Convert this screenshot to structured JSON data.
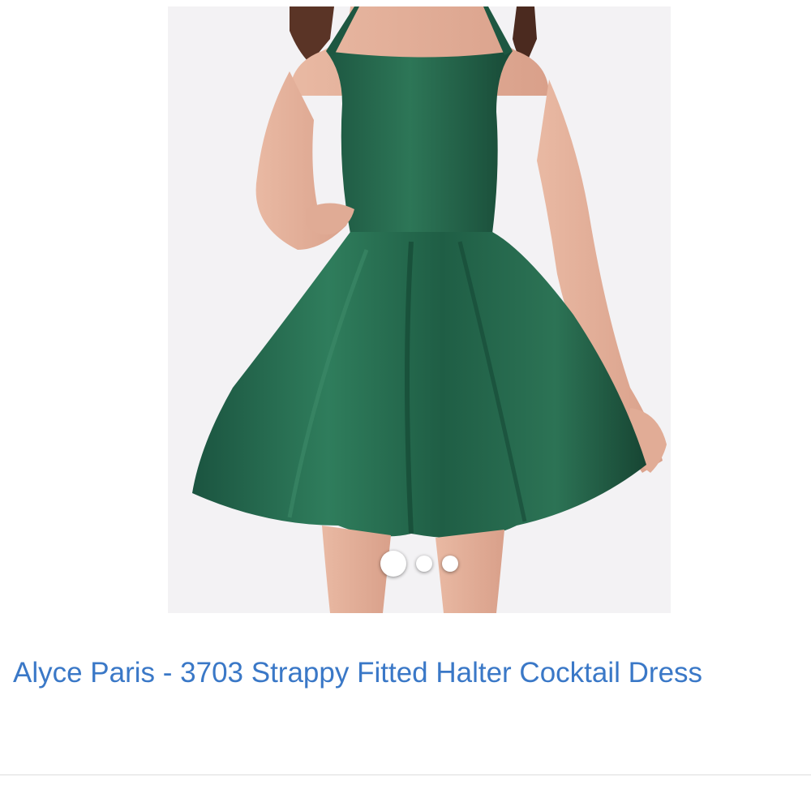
{
  "product": {
    "title": "Alyce Paris - 3703 Strappy Fitted Halter Cocktail Dress",
    "image": {
      "subject": "green-satin-dress-photo",
      "dress_color": "#1f5e45",
      "background_color": "#f3f2f4"
    },
    "carousel": {
      "total": 3,
      "active_index": 0
    }
  },
  "colors": {
    "link": "#3a78c7"
  }
}
